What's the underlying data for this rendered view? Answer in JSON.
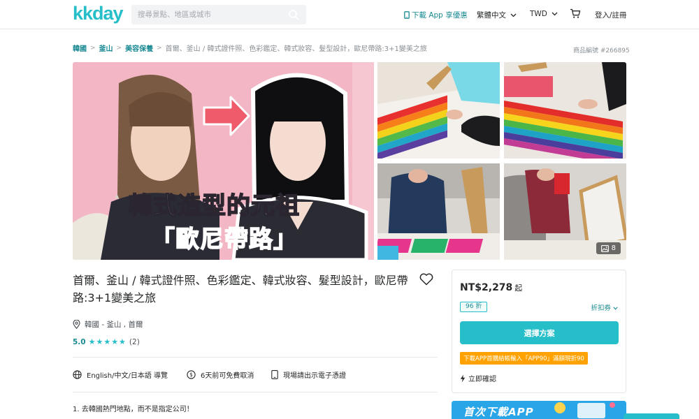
{
  "header": {
    "logo": "kkday",
    "search_placeholder": "搜尋景點、地區或城市",
    "app_link": "下載 App 享優惠",
    "language": "繁體中文",
    "currency": "TWD",
    "login": "登入/註冊"
  },
  "breadcrumb": {
    "items": [
      "韓國",
      "釜山",
      "美容保養"
    ],
    "current": "首爾、釜山 / 韓式證件照、色彩鑑定、韓式妝容、髮型設計，歐尼帶路:3+1變美之旅"
  },
  "product_id": "商品編號 #266895",
  "gallery": {
    "hero_caption_line1": "韓式造型的元祖",
    "hero_caption_line2": "「歐尼帶路」",
    "photo_count": "8"
  },
  "product": {
    "title": "首爾、釜山 / 韓式證件照、色彩鑑定、韓式妝容、髮型設計，歐尼帶路:3+1變美之旅",
    "location": "韓國 - 釜山 , 首爾",
    "rating_score": "5.0",
    "rating_stars": "★★★★★",
    "rating_count": "(2)",
    "features": [
      "English/中文/日本語 導覽",
      "6天前可免費取消",
      "現場請出示電子憑證"
    ],
    "description_first_line": "1. 去韓國熱門地點，而不是指定公司！"
  },
  "booking": {
    "price": "NT$2,278",
    "price_suffix": "起",
    "discount": "96 折",
    "coupon": "折扣券",
    "select_button": "選擇方案",
    "promo": "下載APP首購結帳輸入「APP90」滿額現折90",
    "confirm": "立即確認"
  },
  "app_banner": {
    "text": "首次下載APP"
  },
  "colors": {
    "brand": "#26bec9",
    "brand_dark": "#1a8a93",
    "promo": "#ffa200",
    "hero_bg": "#f3b6c4"
  }
}
